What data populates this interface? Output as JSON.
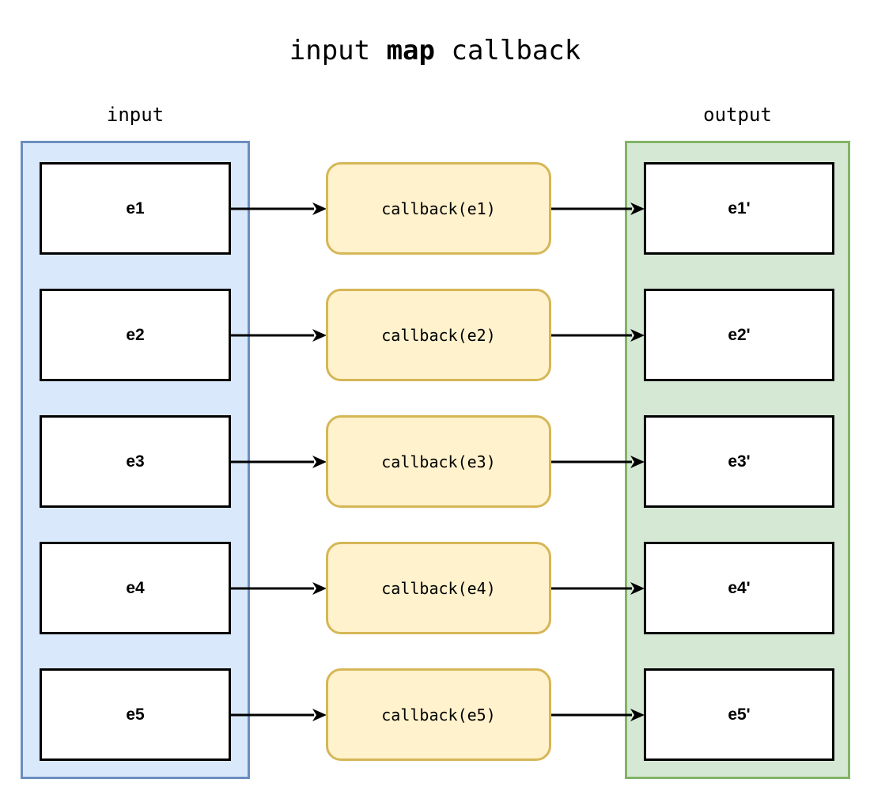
{
  "title": {
    "prefix": "input ",
    "emphasis": "map",
    "suffix": " callback",
    "full": "input map callback"
  },
  "columns": {
    "input_label": "input",
    "output_label": "output"
  },
  "colors": {
    "input_group_fill": "#dae8fc",
    "input_group_border": "#6c8ebf",
    "output_group_fill": "#d5e8d4",
    "output_group_border": "#82b366",
    "callback_fill": "#fff2cc",
    "callback_border": "#d6b656",
    "element_fill": "#ffffff",
    "element_border": "#000000",
    "arrow": "#000000",
    "text": "#000000"
  },
  "rows": [
    {
      "input": "e1",
      "callback": "callback(e1)",
      "output": "e1'"
    },
    {
      "input": "e2",
      "callback": "callback(e2)",
      "output": "e2'"
    },
    {
      "input": "e3",
      "callback": "callback(e3)",
      "output": "e3'"
    },
    {
      "input": "e4",
      "callback": "callback(e4)",
      "output": "e4'"
    },
    {
      "input": "e5",
      "callback": "callback(e5)",
      "output": "e5'"
    }
  ],
  "flow": {
    "arrow_in_to_callback": "arrow-right-icon",
    "arrow_callback_to_out": "arrow-right-icon"
  }
}
